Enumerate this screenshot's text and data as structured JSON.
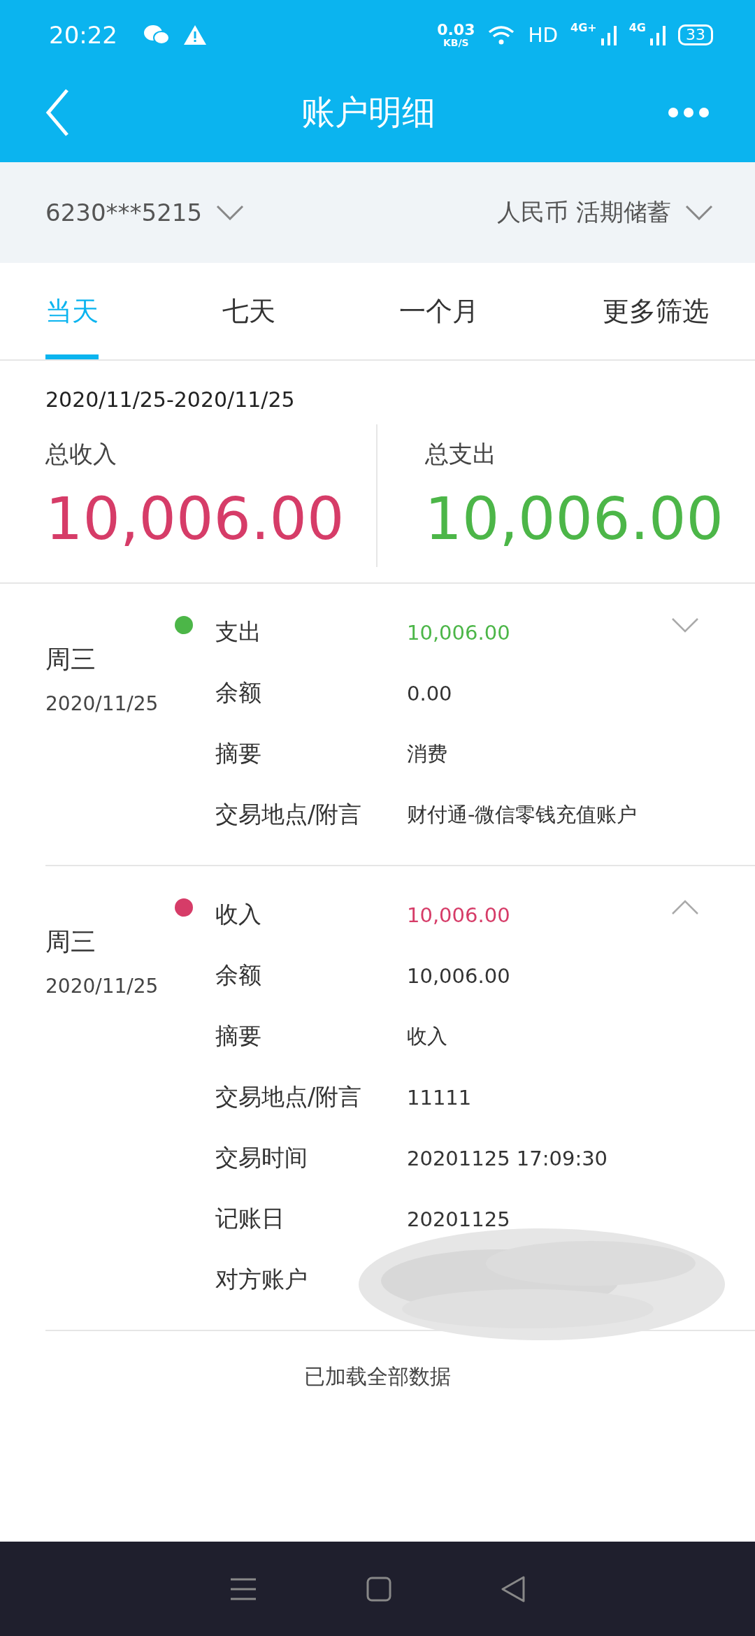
{
  "status_bar": {
    "time": "20:22",
    "speed_value": "0.03",
    "speed_unit": "KB/S",
    "hd": "HD",
    "network_1": "4G+",
    "network_2": "4G",
    "battery": "33"
  },
  "header": {
    "title": "账户明细"
  },
  "account_bar": {
    "account": "6230***5215",
    "account_type": "人民币 活期储蓄"
  },
  "tabs": [
    {
      "label": "当天",
      "selected": true
    },
    {
      "label": "七天",
      "selected": false
    },
    {
      "label": "一个月",
      "selected": false
    },
    {
      "label": "更多筛选",
      "selected": false
    }
  ],
  "summary": {
    "date_range": "2020/11/25-2020/11/25",
    "income_label": "总收入",
    "income": "10,006.00",
    "expense_label": "总支出",
    "expense": "10,006.00"
  },
  "records": [
    {
      "weekday": "周三",
      "date": "2020/11/25",
      "color": "#4cb648",
      "expanded": false,
      "fields": [
        {
          "label": "支出",
          "value": "10,006.00"
        },
        {
          "label": "余额",
          "value": "0.00"
        },
        {
          "label": "摘要",
          "value": "消费"
        },
        {
          "label": "交易地点/附言",
          "value": "财付通-微信零钱充值账户"
        }
      ]
    },
    {
      "weekday": "周三",
      "date": "2020/11/25",
      "color": "#d63c68",
      "expanded": true,
      "fields": [
        {
          "label": "收入",
          "value": "10,006.00"
        },
        {
          "label": "余额",
          "value": "10,006.00"
        },
        {
          "label": "摘要",
          "value": "收入"
        },
        {
          "label": "交易地点/附言",
          "value": "11111"
        },
        {
          "label": "交易时间",
          "value": "20201125 17:09:30"
        },
        {
          "label": "记账日",
          "value": "20201125"
        },
        {
          "label": "对方账户"
        }
      ]
    }
  ],
  "footer": "已加载全部数据"
}
